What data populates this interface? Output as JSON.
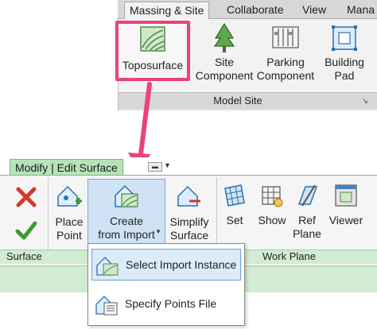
{
  "top_ribbon": {
    "tabs": [
      "Massing & Site",
      "Collaborate",
      "View",
      "Mana"
    ],
    "active_tab": "Massing & Site",
    "panel_label": "Model Site",
    "tools": [
      {
        "label": "Toposurface",
        "icon": "toposurface-icon",
        "highlighted": true
      },
      {
        "label": "Site Component",
        "icon": "tree-icon"
      },
      {
        "label": "Parking Component",
        "icon": "parking-icon"
      },
      {
        "label": "Building Pad",
        "icon": "building-pad-icon"
      }
    ]
  },
  "bottom_ribbon": {
    "context_tab": "Modify | Edit Surface",
    "groups": {
      "surface": "Surface",
      "work_plane": "Work Plane"
    },
    "buttons": {
      "place_point": [
        "Place",
        "Point"
      ],
      "create_from_import": [
        "Create",
        "from Import"
      ],
      "simplify_surface": [
        "Simplify",
        "Surface"
      ],
      "set": "Set",
      "show": "Show",
      "ref_plane": [
        "Ref",
        "Plane"
      ],
      "viewer": "Viewer"
    }
  },
  "import_menu": {
    "items": [
      {
        "label": "Select Import Instance",
        "highlighted": true
      },
      {
        "label": "Specify Points File",
        "highlighted": false
      }
    ]
  },
  "colors": {
    "highlight_border": "#e9437d",
    "context_tab_green": "#b9e2b9",
    "selection_blue": "#cfe3f5",
    "arrow_pink": "#e9437d"
  }
}
